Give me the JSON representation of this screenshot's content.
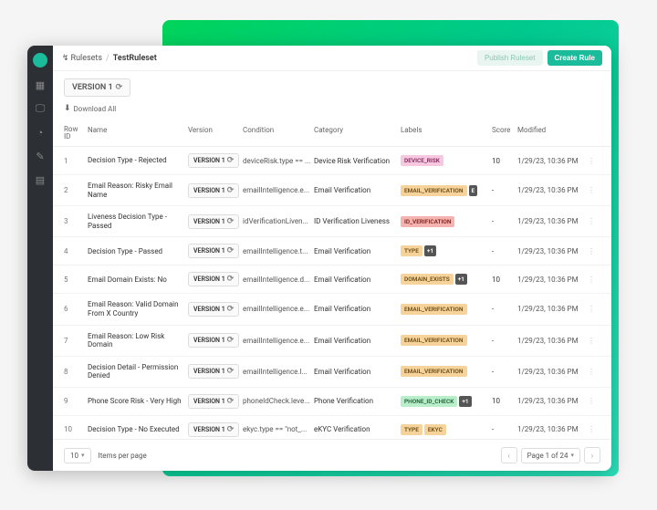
{
  "breadcrumb": {
    "root": "Rulesets",
    "current": "TestRuleset"
  },
  "buttons": {
    "publish": "Publish Ruleset",
    "create": "Create Rule"
  },
  "version_tab": "VERSION 1",
  "download_all": "Download All",
  "columns": {
    "rowid": "Row\nID",
    "name": "Name",
    "version": "Version",
    "condition": "Condition",
    "category": "Category",
    "labels": "Labels",
    "score": "Score",
    "modified": "Modified"
  },
  "ver_pill": "VERSION 1",
  "label_colors": {
    "DEVICE_RISK": {
      "bg": "#f7c8e0",
      "fg": "#7a2a55"
    },
    "EMAIL_VERIFICATION": {
      "bg": "#f5d39a",
      "fg": "#6b4a15"
    },
    "ID_VERIFICATION": {
      "bg": "#f5b3b0",
      "fg": "#7a1f1c"
    },
    "TYPE": {
      "bg": "#f5d39a",
      "fg": "#6b4a15"
    },
    "DOMAIN_EXISTS": {
      "bg": "#f5d39a",
      "fg": "#6b4a15"
    },
    "PHONE_ID_CHECK": {
      "bg": "#b8eec9",
      "fg": "#1f5c37"
    },
    "EKYC": {
      "bg": "#f5d39a",
      "fg": "#6b4a15"
    }
  },
  "rows": [
    {
      "id": "1",
      "name": "Decision Type - Rejected",
      "condition": "deviceRisk.type == ...",
      "category": "Device Risk Verification",
      "labels": [
        "DEVICE_RISK"
      ],
      "extra": null,
      "score": "10",
      "modified": "1/29/23, 10:36 PM"
    },
    {
      "id": "2",
      "name": "Email Reason: Risky Email Name",
      "condition": "emailIntelligence.e...",
      "category": "Email Verification",
      "labels": [
        "EMAIL_VERIFICATION"
      ],
      "extra": "E",
      "score": "-",
      "modified": "1/29/23, 10:36 PM"
    },
    {
      "id": "3",
      "name": "Liveness Decision Type - Passed",
      "condition": "idVerificationLiven...",
      "category": "ID Verification Liveness",
      "labels": [
        "ID_VERIFICATION"
      ],
      "extra": null,
      "score": "-",
      "modified": "1/29/23, 10:36 PM"
    },
    {
      "id": "4",
      "name": "Decision Type - Passed",
      "condition": "emailIntelligence.t...",
      "category": "Email Verification",
      "labels": [
        "TYPE"
      ],
      "extra": "+1",
      "score": "-",
      "modified": "1/29/23, 10:36 PM"
    },
    {
      "id": "5",
      "name": "Email Domain Exists: No",
      "condition": "emailIntelligence.d...",
      "category": "Email Verification",
      "labels": [
        "DOMAIN_EXISTS"
      ],
      "extra": "+1",
      "score": "10",
      "modified": "1/29/23, 10:36 PM"
    },
    {
      "id": "6",
      "name": "Email Reason: Valid Domain From X Country",
      "condition": "emailIntelligence.e...",
      "category": "Email Verification",
      "labels": [
        "EMAIL_VERIFICATION"
      ],
      "extra": null,
      "score": "-",
      "modified": "1/29/23, 10:36 PM"
    },
    {
      "id": "7",
      "name": "Email Reason: Low Risk Domain",
      "condition": "emailIntelligence.e...",
      "category": "Email Verification",
      "labels": [
        "EMAIL_VERIFICATION"
      ],
      "extra": null,
      "score": "-",
      "modified": "1/29/23, 10:36 PM"
    },
    {
      "id": "8",
      "name": "Decision Detail - Permission Denied",
      "condition": "emailIntelligence.l...",
      "category": "Email Verification",
      "labels": [
        "EMAIL_VERIFICATION"
      ],
      "extra": null,
      "score": "-",
      "modified": "1/29/23, 10:36 PM"
    },
    {
      "id": "9",
      "name": "Phone Score Risk - Very High",
      "condition": "phoneIdCheck.leve...",
      "category": "Phone Verification",
      "labels": [
        "PHONE_ID_CHECK"
      ],
      "extra": "+1",
      "score": "10",
      "modified": "1/29/23, 10:36 PM"
    },
    {
      "id": "10",
      "name": "Decision Type - No Executed",
      "condition": "ekyc.type == \"not_...",
      "category": "eKYC Verification",
      "labels": [
        "TYPE",
        "EKYC"
      ],
      "extra": null,
      "score": "-",
      "modified": "1/29/23, 10:36 PM"
    }
  ],
  "footer": {
    "page_size": "10",
    "items_label": "Items per page",
    "page_text": "Page 1 of 24"
  }
}
